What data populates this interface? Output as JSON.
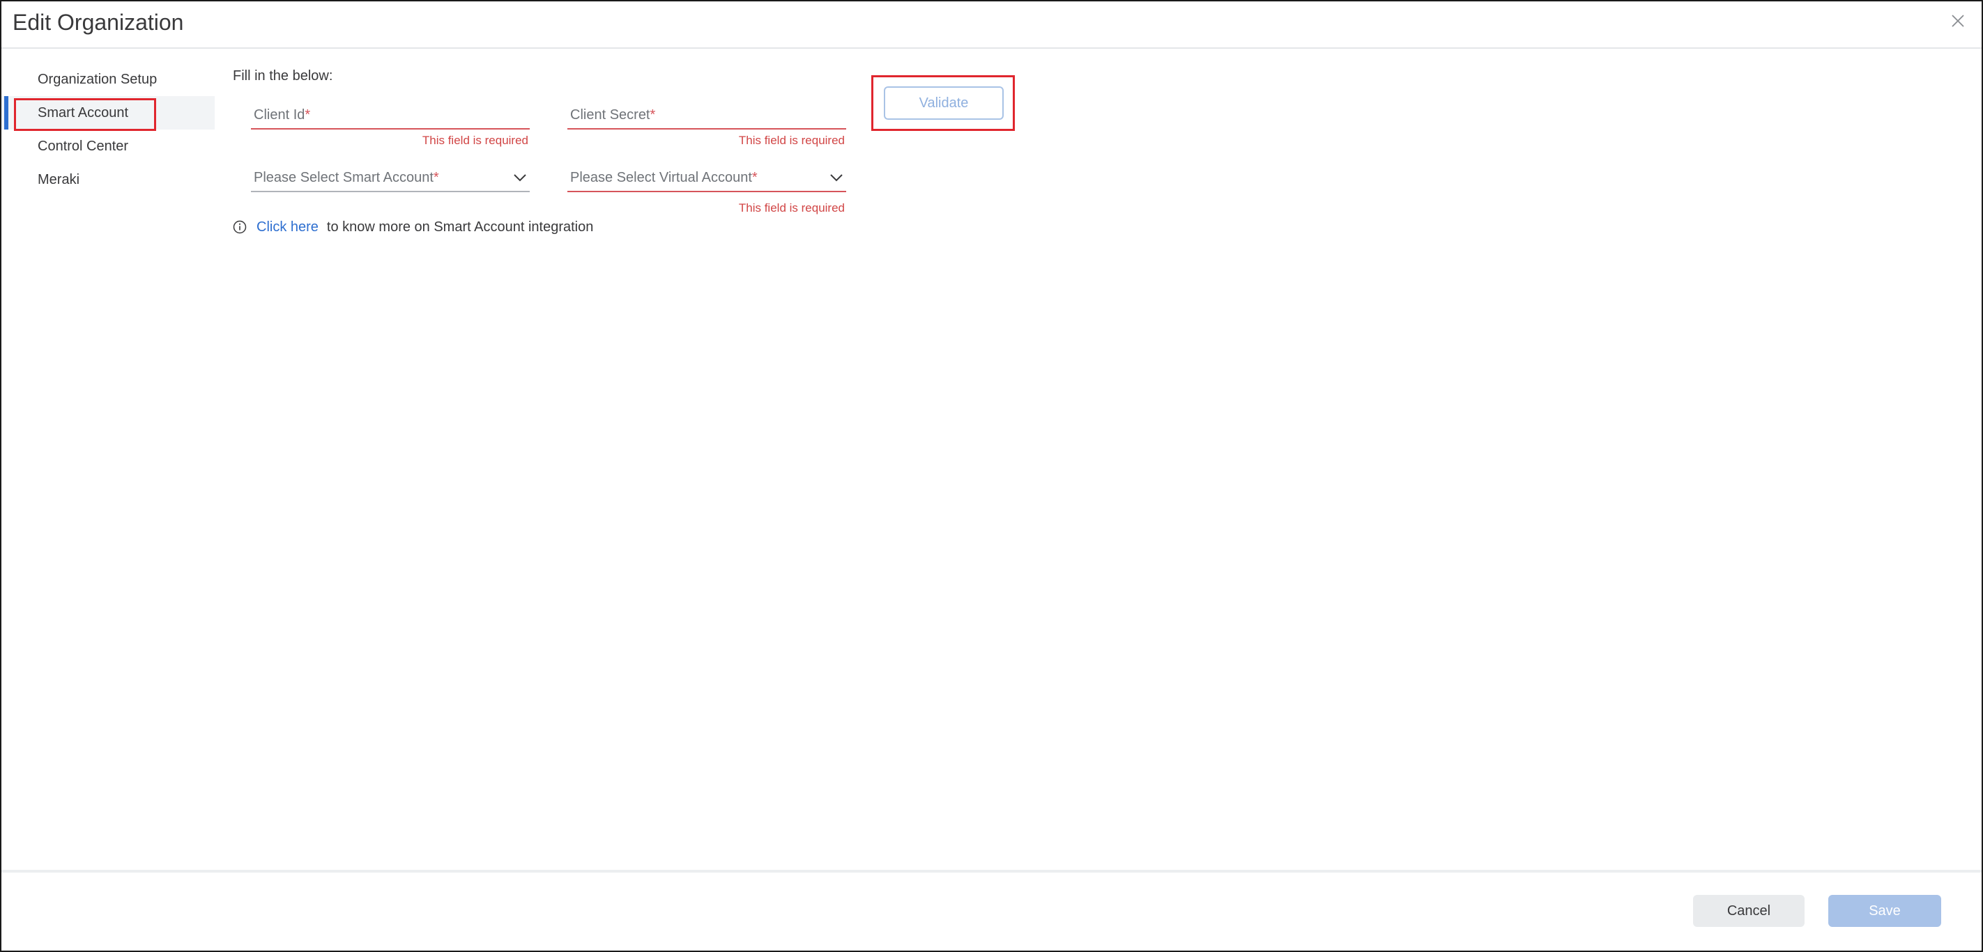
{
  "dialog": {
    "title": "Edit Organization"
  },
  "sidebar": {
    "items": [
      {
        "label": "Organization Setup"
      },
      {
        "label": "Smart Account"
      },
      {
        "label": "Control Center"
      },
      {
        "label": "Meraki"
      }
    ],
    "active": "Smart Account"
  },
  "form": {
    "intro": "Fill in the below:",
    "client_id": {
      "placeholder": "Client Id",
      "required_mark": "*",
      "error": "This field is required"
    },
    "client_secret": {
      "placeholder": "Client Secret",
      "required_mark": "*",
      "error": "This field is required"
    },
    "smart_account": {
      "placeholder": "Please Select Smart Account",
      "required_mark": "*"
    },
    "virtual_account": {
      "placeholder": "Please Select Virtual Account",
      "required_mark": "*",
      "error": "This field is required"
    },
    "validate_label": "Validate",
    "info": {
      "link_text": "Click here",
      "text": "to know more on Smart Account integration"
    }
  },
  "footer": {
    "cancel_label": "Cancel",
    "save_label": "Save"
  },
  "colors": {
    "accent": "#2e6fd0",
    "error": "#d14545",
    "highlight": "#e0262e",
    "disabled_primary": "#a8c2e8"
  },
  "icons": [
    "close-icon",
    "chevron-down-icon",
    "info-icon"
  ]
}
